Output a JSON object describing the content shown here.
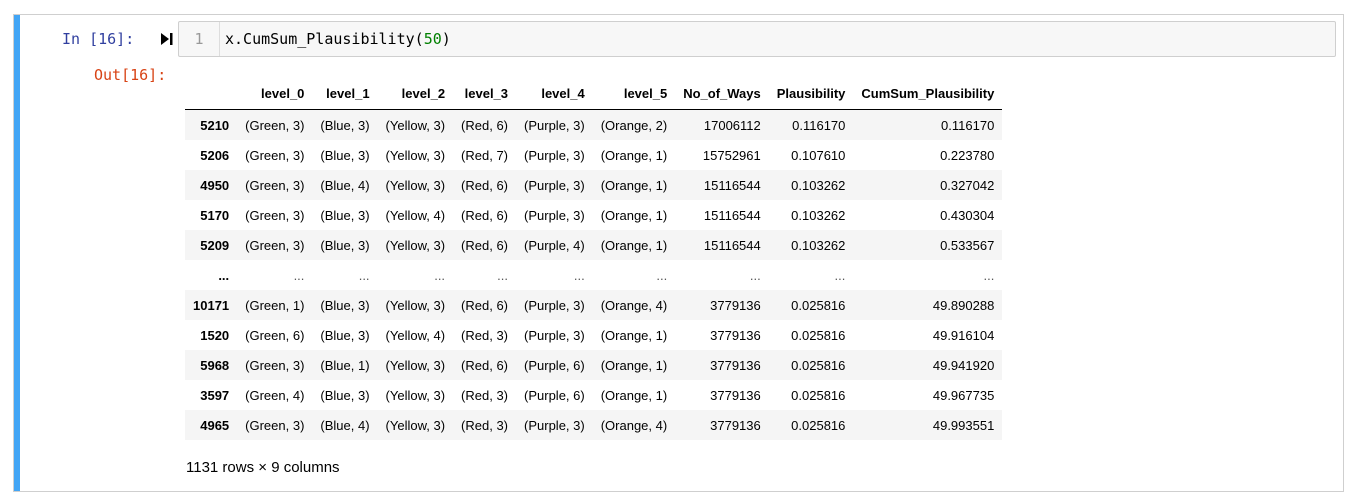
{
  "input": {
    "prompt": "In [16]:",
    "line_number": "1",
    "code_prefix": "x.CumSum_Plausibility(",
    "code_arg": "50",
    "code_suffix": ")"
  },
  "output": {
    "prompt": "Out[16]:",
    "columns": [
      "",
      "level_0",
      "level_1",
      "level_2",
      "level_3",
      "level_4",
      "level_5",
      "No_of_Ways",
      "Plausibility",
      "CumSum_Plausibility"
    ],
    "rows": [
      [
        "5210",
        "(Green, 3)",
        "(Blue, 3)",
        "(Yellow, 3)",
        "(Red, 6)",
        "(Purple, 3)",
        "(Orange, 2)",
        "17006112",
        "0.116170",
        "0.116170"
      ],
      [
        "5206",
        "(Green, 3)",
        "(Blue, 3)",
        "(Yellow, 3)",
        "(Red, 7)",
        "(Purple, 3)",
        "(Orange, 1)",
        "15752961",
        "0.107610",
        "0.223780"
      ],
      [
        "4950",
        "(Green, 3)",
        "(Blue, 4)",
        "(Yellow, 3)",
        "(Red, 6)",
        "(Purple, 3)",
        "(Orange, 1)",
        "15116544",
        "0.103262",
        "0.327042"
      ],
      [
        "5170",
        "(Green, 3)",
        "(Blue, 3)",
        "(Yellow, 4)",
        "(Red, 6)",
        "(Purple, 3)",
        "(Orange, 1)",
        "15116544",
        "0.103262",
        "0.430304"
      ],
      [
        "5209",
        "(Green, 3)",
        "(Blue, 3)",
        "(Yellow, 3)",
        "(Red, 6)",
        "(Purple, 4)",
        "(Orange, 1)",
        "15116544",
        "0.103262",
        "0.533567"
      ],
      [
        "...",
        "...",
        "...",
        "...",
        "...",
        "...",
        "...",
        "...",
        "...",
        "..."
      ],
      [
        "10171",
        "(Green, 1)",
        "(Blue, 3)",
        "(Yellow, 3)",
        "(Red, 6)",
        "(Purple, 3)",
        "(Orange, 4)",
        "3779136",
        "0.025816",
        "49.890288"
      ],
      [
        "1520",
        "(Green, 6)",
        "(Blue, 3)",
        "(Yellow, 4)",
        "(Red, 3)",
        "(Purple, 3)",
        "(Orange, 1)",
        "3779136",
        "0.025816",
        "49.916104"
      ],
      [
        "5968",
        "(Green, 3)",
        "(Blue, 1)",
        "(Yellow, 3)",
        "(Red, 6)",
        "(Purple, 6)",
        "(Orange, 1)",
        "3779136",
        "0.025816",
        "49.941920"
      ],
      [
        "3597",
        "(Green, 4)",
        "(Blue, 3)",
        "(Yellow, 3)",
        "(Red, 3)",
        "(Purple, 6)",
        "(Orange, 1)",
        "3779136",
        "0.025816",
        "49.967735"
      ],
      [
        "4965",
        "(Green, 3)",
        "(Blue, 4)",
        "(Yellow, 3)",
        "(Red, 3)",
        "(Purple, 3)",
        "(Orange, 4)",
        "3779136",
        "0.025816",
        "49.993551"
      ]
    ],
    "shape_info": "1131 rows × 9 columns"
  },
  "icons": {
    "run": "run-cell-icon"
  },
  "colors": {
    "cell_bar": "#42a5f5",
    "in_prompt": "#303f9f",
    "out_prompt": "#d84315",
    "number_literal": "#008000"
  }
}
